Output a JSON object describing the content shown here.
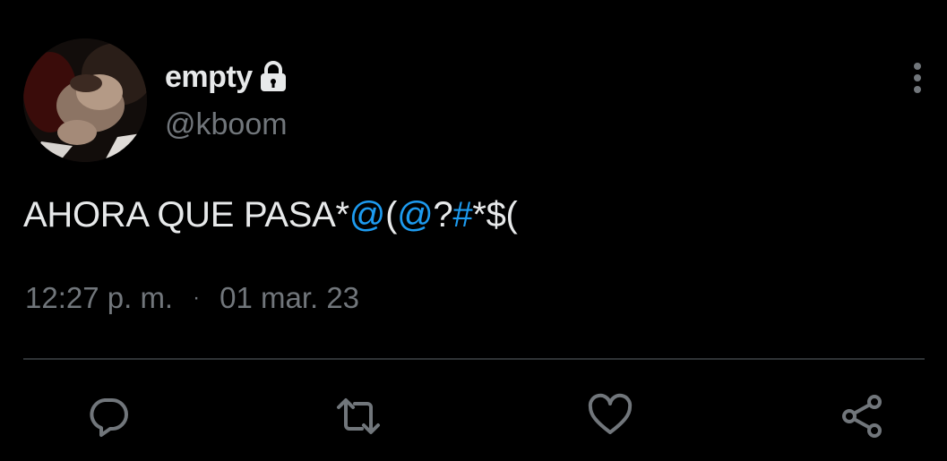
{
  "user": {
    "display_name": "empty",
    "handle": "@kboom",
    "protected_icon": "lock-icon",
    "avatar": "profile-photo"
  },
  "tweet": {
    "text_plain": "AHORA QUE PASA*",
    "link_1": "@",
    "text_mid": "(",
    "link_2": "@",
    "text_mid2": "?",
    "link_3": "#",
    "text_end": "*$(",
    "time": "12:27 p. m.",
    "separator": "·",
    "date": "01 mar. 23"
  },
  "actions": [
    {
      "name": "reply",
      "icon": "reply-icon"
    },
    {
      "name": "retweet",
      "icon": "retweet-icon"
    },
    {
      "name": "like",
      "icon": "heart-icon"
    },
    {
      "name": "share",
      "icon": "share-icon"
    }
  ],
  "menu": {
    "icon": "more-vertical-icon"
  },
  "colors": {
    "background": "#000000",
    "primary_text": "#e7e9ea",
    "secondary_text": "#71767b",
    "link": "#1d9bf0",
    "divider": "#2f3336"
  }
}
